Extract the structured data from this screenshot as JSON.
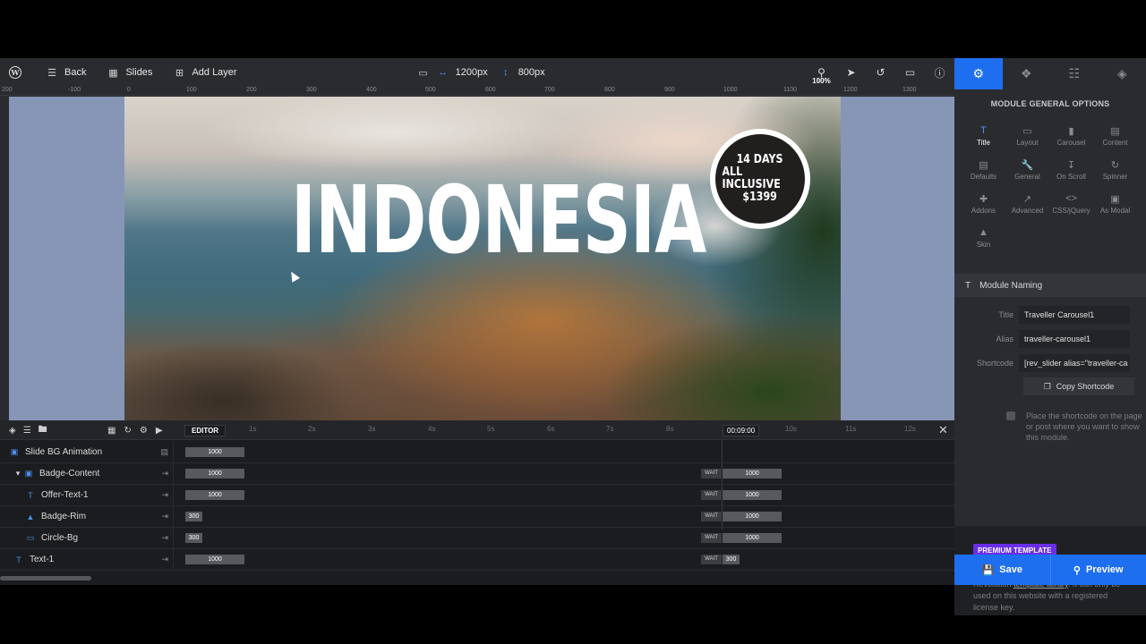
{
  "topbar": {
    "back_label": "Back",
    "slides_label": "Slides",
    "add_layer_label": "Add Layer",
    "width_value": "1200px",
    "height_value": "800px",
    "zoom_label": "100%"
  },
  "ruler": {
    "ticks": [
      "200",
      "-100",
      "0",
      "100",
      "200",
      "300",
      "400",
      "500",
      "600",
      "700",
      "800",
      "900",
      "1000",
      "1100",
      "1200",
      "1300"
    ]
  },
  "slide": {
    "headline": "INDONESIA",
    "badge_line1": "14 DAYS",
    "badge_line2": "ALL INCLUSIVE",
    "badge_line3": "$1399"
  },
  "right_panel": {
    "title": "MODULE GENERAL OPTIONS",
    "options": [
      {
        "label": "Title",
        "icon": "title-icon"
      },
      {
        "label": "Layout",
        "icon": "layout-icon"
      },
      {
        "label": "Carousel",
        "icon": "carousel-icon"
      },
      {
        "label": "Content",
        "icon": "content-icon"
      },
      {
        "label": "Defaults",
        "icon": "defaults-icon"
      },
      {
        "label": "General",
        "icon": "wrench-icon"
      },
      {
        "label": "On Scroll",
        "icon": "scroll-icon"
      },
      {
        "label": "Spinner",
        "icon": "spinner-icon"
      },
      {
        "label": "Addons",
        "icon": "puzzle-icon"
      },
      {
        "label": "Advanced",
        "icon": "chart-icon"
      },
      {
        "label": "CSS/jQuery",
        "icon": "code-icon"
      },
      {
        "label": "As Modal",
        "icon": "modal-icon"
      },
      {
        "label": "Skin",
        "icon": "brush-icon"
      }
    ],
    "naming_section": "Module Naming",
    "title_label": "Title",
    "title_value": "Traveller Carousel1",
    "alias_label": "Alias",
    "alias_value": "traveller-carousel1",
    "shortcode_label": "Shortcode",
    "shortcode_value": "[rev_slider alias=\"traveller-ca",
    "copy_button": "Copy Shortcode",
    "hint": "Place the shortcode on the page or post where you want to show this module.",
    "premium_badge": "PREMIUM TEMPLATE",
    "premium_text_before": "This is a Premium template from the Slider Revolution ",
    "premium_link": "template library",
    "premium_text_after": ". It can only be used on this website with a registered license key.",
    "save_label": "Save",
    "preview_label": "Preview"
  },
  "timeline": {
    "editor_label": "EDITOR",
    "ticks": [
      "1s",
      "2s",
      "3s",
      "4s",
      "5s",
      "6s",
      "7s",
      "8s",
      "10s",
      "11s",
      "12s"
    ],
    "playhead_time": "00:09:00",
    "rows": [
      {
        "name": "Slide BG Animation",
        "bar1": "1000",
        "wait": "",
        "bar2": ""
      },
      {
        "name": "Badge-Content",
        "bar1": "1000",
        "wait": "WAIT",
        "bar2": "1000"
      },
      {
        "name": "Offer-Text-1",
        "bar1": "1000",
        "wait": "WAIT",
        "bar2": "1000"
      },
      {
        "name": "Badge-Rim",
        "bar1": "300",
        "wait": "WAIT",
        "bar2": "1000"
      },
      {
        "name": "Circle-Bg",
        "bar1": "300",
        "wait": "WAIT",
        "bar2": "1000"
      },
      {
        "name": "Text-1",
        "bar1": "1000",
        "wait": "WAIT",
        "bar2": "300"
      }
    ]
  },
  "colors": {
    "accent": "#1e6ef0",
    "premium": "#6a2ee8",
    "stage_bg": "#8796b6"
  }
}
